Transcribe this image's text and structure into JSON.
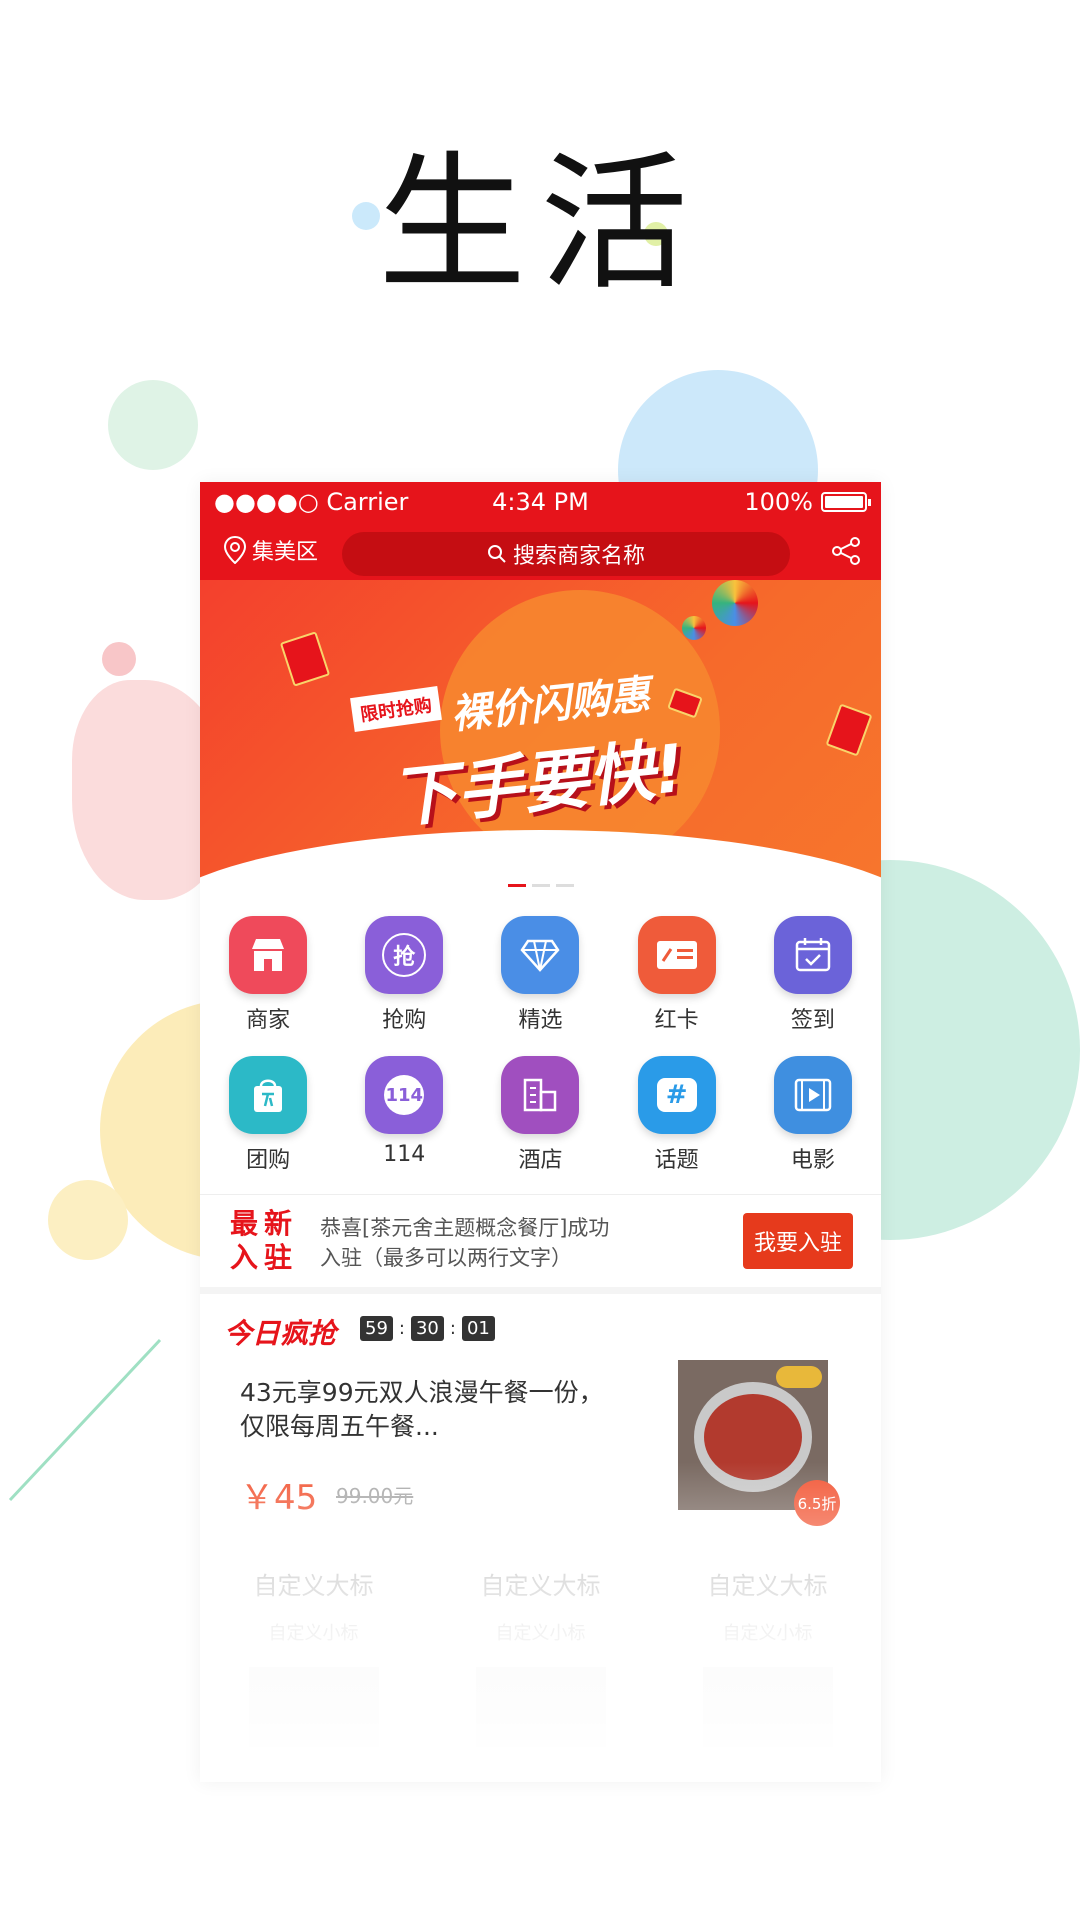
{
  "headline": "生活",
  "status_bar": {
    "carrier": "●●●●○ Carrier",
    "time": "4:34 PM",
    "battery": "100%",
    "battery_level": 1.0
  },
  "nav": {
    "location": "集美区",
    "search_placeholder": "搜索商家名称"
  },
  "banner": {
    "tag": "限时抢购",
    "title1": "裸价闪购惠",
    "title2": "下手要快!",
    "active_slide": 1,
    "slide_count": 3
  },
  "grid": [
    [
      {
        "label": "商家",
        "icon": "shop-icon",
        "color": "#ef4a5b"
      },
      {
        "label": "抢购",
        "icon": "grab-icon",
        "color": "#8a5fd9",
        "glyph": "抢"
      },
      {
        "label": "精选",
        "icon": "diamond-icon",
        "color": "#4a8ee6"
      },
      {
        "label": "红卡",
        "icon": "card-icon",
        "color": "#ef5b3a"
      },
      {
        "label": "签到",
        "icon": "calendar-icon",
        "color": "#6b63d9"
      }
    ],
    [
      {
        "label": "团购",
        "icon": "bag-icon",
        "color": "#2cb9c7"
      },
      {
        "label": "114",
        "icon": "phone-114-icon",
        "color": "#8a5fd9",
        "glyph": "114"
      },
      {
        "label": "酒店",
        "icon": "hotel-icon",
        "color": "#a04fbf"
      },
      {
        "label": "话题",
        "icon": "topic-icon",
        "color": "#2a9be8",
        "glyph": "#"
      },
      {
        "label": "电影",
        "icon": "movie-icon",
        "color": "#3f8fe0"
      }
    ]
  ],
  "new_merchant": {
    "badge": "最新入驻",
    "message": "恭喜[茶元舍主题概念餐厅]成功入驻（最多可以两行文字）",
    "button": "我要入驻"
  },
  "flash_sale": {
    "title": "今日疯抢",
    "timer": [
      "59",
      "30",
      "01"
    ],
    "description": "43元享99元双人浪漫午餐一份，仅限每周五午餐...",
    "price": "￥45",
    "old_price": "99.00元",
    "discount": "6.5折"
  },
  "more": [
    {
      "title": "自定义大标",
      "subtitle": "自定义小标"
    },
    {
      "title": "自定义大标",
      "subtitle": "自定义小标"
    },
    {
      "title": "自定义大标",
      "subtitle": "自定义小标"
    }
  ],
  "colors": {
    "brand_red": "#e6141b",
    "accent_orange": "#e63a1c"
  }
}
